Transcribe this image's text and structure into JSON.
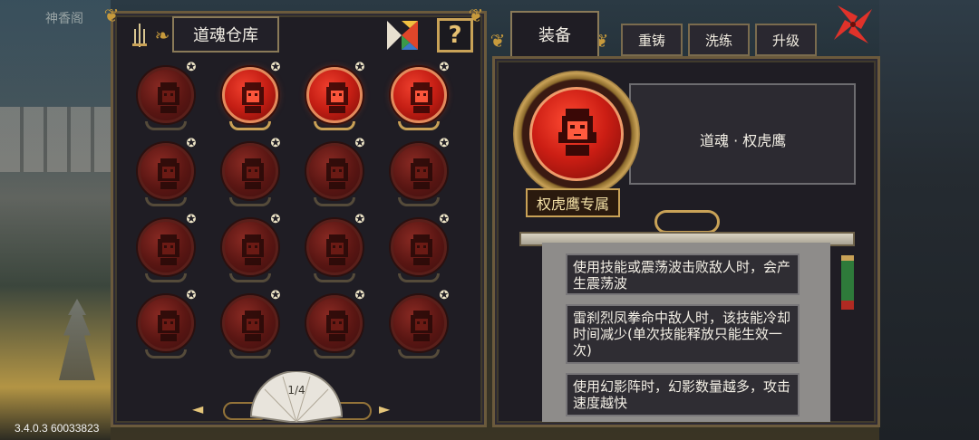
{
  "version": "3.4.0.3 60033823",
  "background": {
    "sign_text": "神香阁"
  },
  "left_panel": {
    "title": "道魂仓库",
    "tangram_icon": "tangram-icon",
    "help_label": "?",
    "pager": {
      "page": "1/4",
      "prev": "◄",
      "next": "►"
    }
  },
  "souls": [
    {
      "active": false,
      "star": "✪"
    },
    {
      "active": true,
      "star": "✪"
    },
    {
      "active": true,
      "star": "✪"
    },
    {
      "active": true,
      "star": "✪"
    },
    {
      "active": false,
      "star": "✪"
    },
    {
      "active": false,
      "star": "✪"
    },
    {
      "active": false,
      "star": "✪"
    },
    {
      "active": false,
      "star": "✪"
    },
    {
      "active": false,
      "star": "✪"
    },
    {
      "active": false,
      "star": "✪"
    },
    {
      "active": false,
      "star": "✪"
    },
    {
      "active": false,
      "star": "✪"
    },
    {
      "active": false,
      "star": "✪"
    },
    {
      "active": false,
      "star": "✪"
    },
    {
      "active": false,
      "star": "✪"
    },
    {
      "active": false,
      "star": "✪"
    }
  ],
  "right_panel": {
    "equip_tab": "装备",
    "tabs": [
      "重铸",
      "洗练",
      "升级"
    ],
    "item_name": "道魂 · 权虎鹰",
    "exclusive_label": "权虎鹰专属",
    "effects": [
      "使用技能或震荡波击败敌人时，会产生震荡波",
      "雷刹烈凤拳命中敌人时，该技能冷却时间减少(单次技能释放只能生效一次)",
      "使用幻影阵时，幻影数量越多，攻击速度越快"
    ]
  },
  "colors": {
    "gold": "#c9a257",
    "orb_active": "#cc1e14",
    "orb_inactive": "#5a1613",
    "panel_bg": "#1f1d24",
    "close_red": "#e0322a"
  }
}
